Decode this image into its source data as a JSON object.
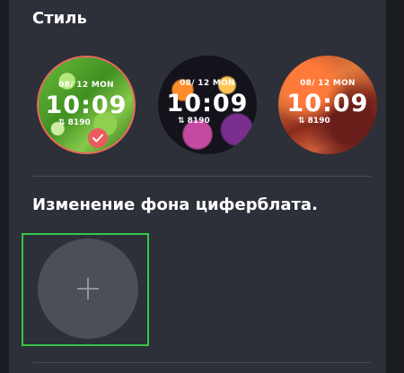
{
  "style_section": {
    "title": "Стиль",
    "faces": [
      {
        "date": "08/ 12  MON",
        "time": "10:09",
        "steps": "⇅ 8190",
        "selected": true,
        "theme": "green-leaf"
      },
      {
        "date": "08/ 12  MON",
        "time": "10:09",
        "steps": "⇅ 8190",
        "selected": false,
        "theme": "bokeh-night"
      },
      {
        "date": "08/ 12  MON",
        "time": "10:09",
        "steps": "⇅ 8190",
        "selected": false,
        "theme": "red-canyon"
      }
    ]
  },
  "background_section": {
    "title": "Изменение фона циферблата.",
    "add_button_icon": "plus-icon"
  },
  "colors": {
    "page_background": "#1b1c22",
    "panel_background": "#2d3038",
    "selected_ring": "#e8695b",
    "check_badge": "#ec5b5b",
    "highlight_outline": "#35c64a",
    "add_button": "#4c4f58"
  }
}
